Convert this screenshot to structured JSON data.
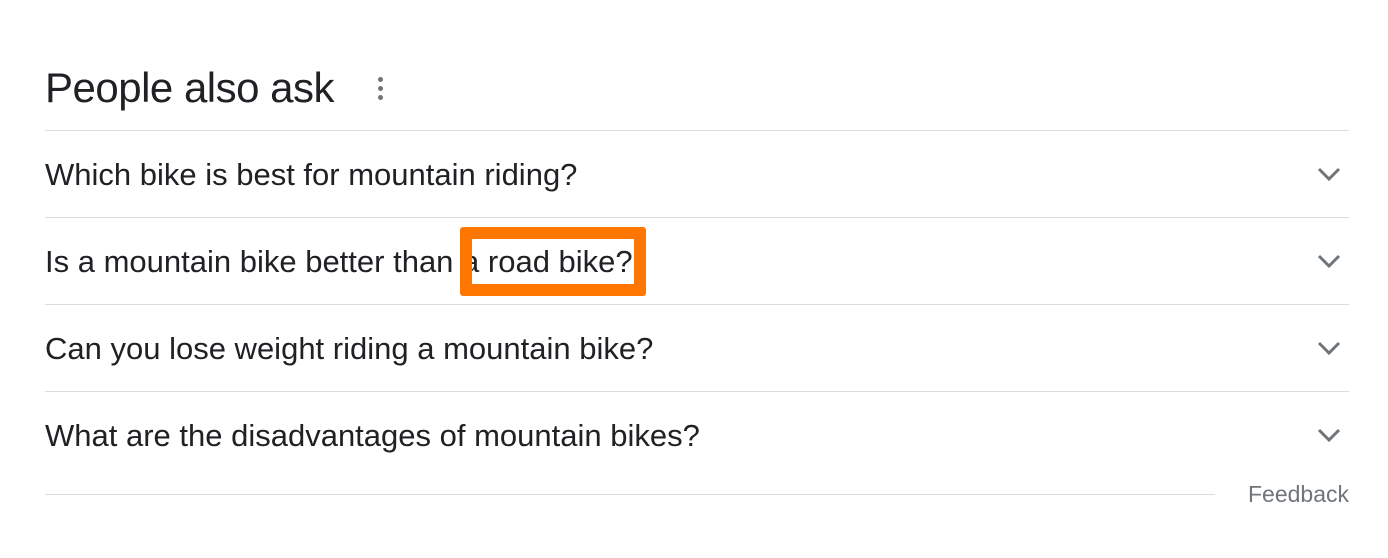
{
  "section": {
    "title": "People also ask"
  },
  "questions": [
    {
      "text": "Which bike is best for mountain riding?"
    },
    {
      "text": "Is a mountain bike better than a road bike?"
    },
    {
      "text": "Can you lose weight riding a mountain bike?"
    },
    {
      "text": "What are the disadvantages of mountain bikes?"
    }
  ],
  "feedback": {
    "label": "Feedback"
  },
  "icons": {
    "more": "more-vert-icon",
    "expand": "chevron-down-icon"
  },
  "colors": {
    "highlight": "#ff7600",
    "text": "#202124",
    "muted": "#70757a",
    "divider": "#dadce0"
  }
}
